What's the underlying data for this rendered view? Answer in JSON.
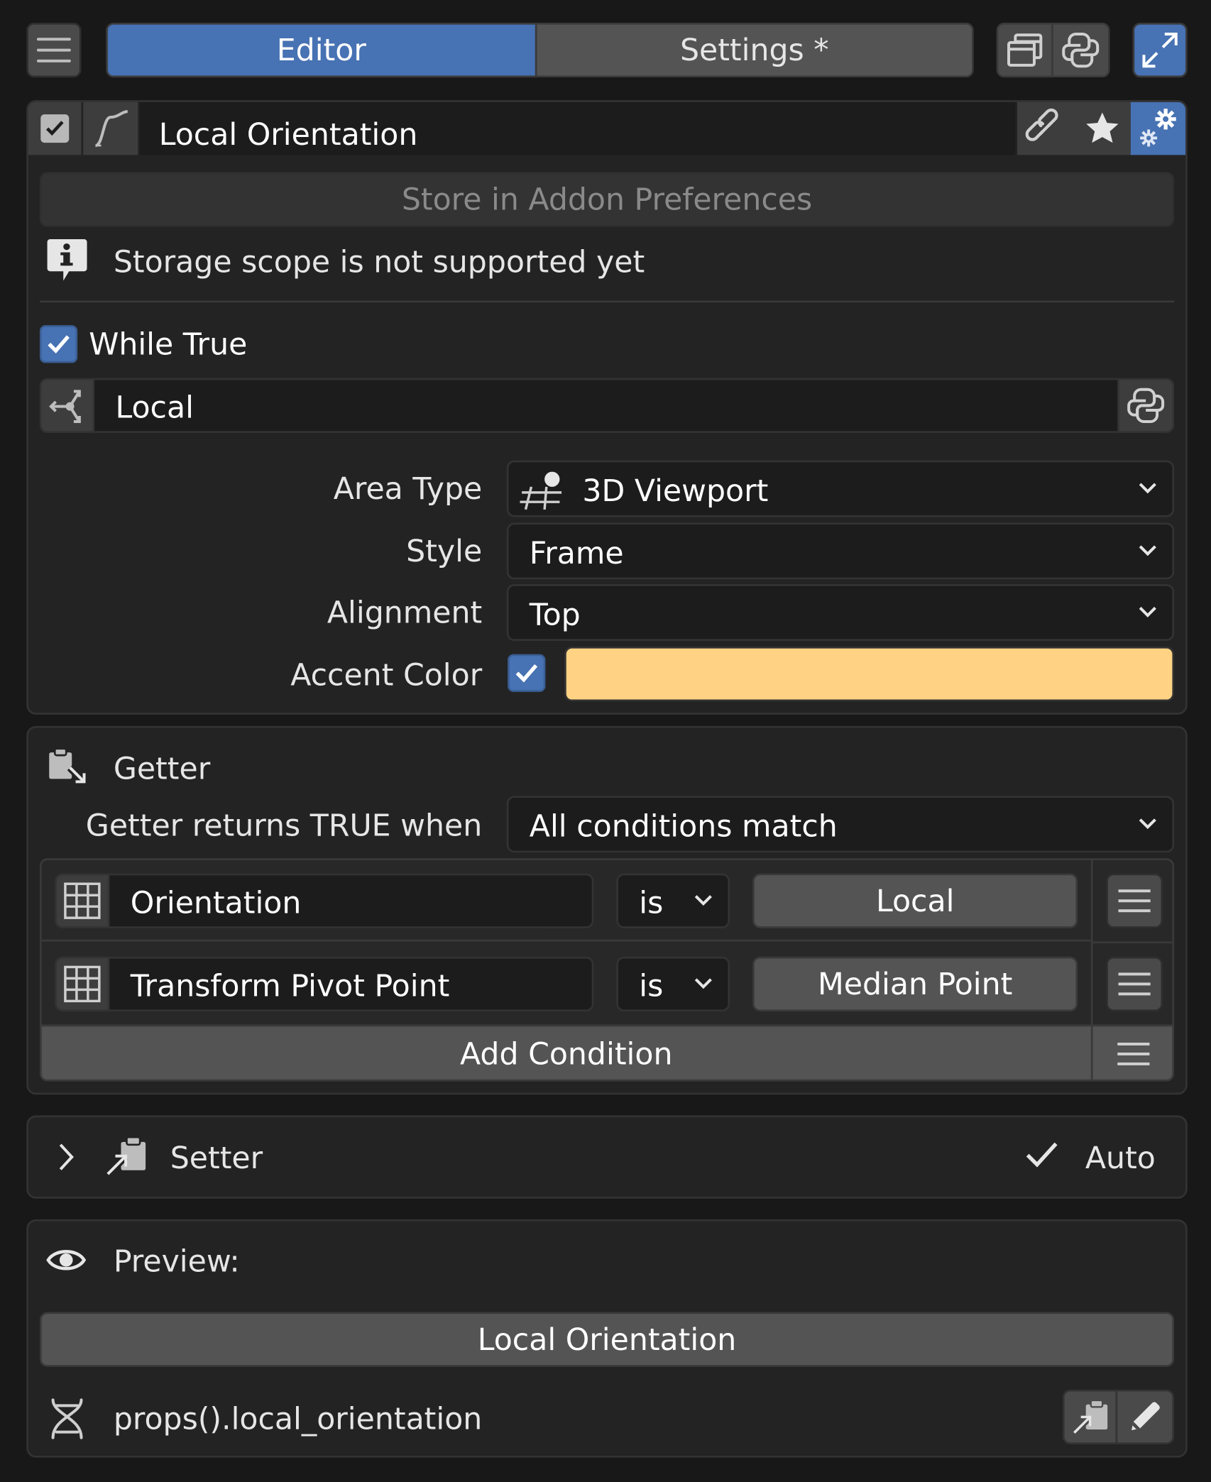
{
  "header": {
    "tab_editor": "Editor",
    "tab_settings": "Settings *",
    "icons": [
      "menu-icon",
      "window-icon",
      "python-icon",
      "fullscreen-icon"
    ]
  },
  "item": {
    "enabled": true,
    "name": "Local Orientation",
    "icons": [
      "curve-icon",
      "link-icon",
      "star-icon",
      "addon-prefs-icon"
    ]
  },
  "store_button": "Store in Addon Preferences",
  "info_message": "Storage scope is not supported yet",
  "while_true": {
    "label": "While True",
    "checked": true
  },
  "orientation_field": "Local",
  "props": {
    "area_type": {
      "label": "Area Type",
      "value": "3D Viewport"
    },
    "style": {
      "label": "Style",
      "value": "Frame"
    },
    "alignment": {
      "label": "Alignment",
      "value": "Top"
    },
    "accent_color": {
      "label": "Accent Color",
      "checked": true,
      "color": "#ffd383"
    }
  },
  "getter": {
    "title": "Getter",
    "returns_label": "Getter returns TRUE when",
    "returns_value": "All conditions match",
    "conditions": [
      {
        "property": "Orientation",
        "operator": "is",
        "value": "Local"
      },
      {
        "property": "Transform Pivot Point",
        "operator": "is",
        "value": "Median Point"
      }
    ],
    "add_button": "Add Condition"
  },
  "setter": {
    "title": "Setter",
    "auto_label": "Auto"
  },
  "preview": {
    "title": "Preview:",
    "button": "Local Orientation",
    "path": "props().local_orientation"
  },
  "colors": {
    "accent_blue": "#4772b3",
    "accent_color_swatch": "#ffd383"
  }
}
